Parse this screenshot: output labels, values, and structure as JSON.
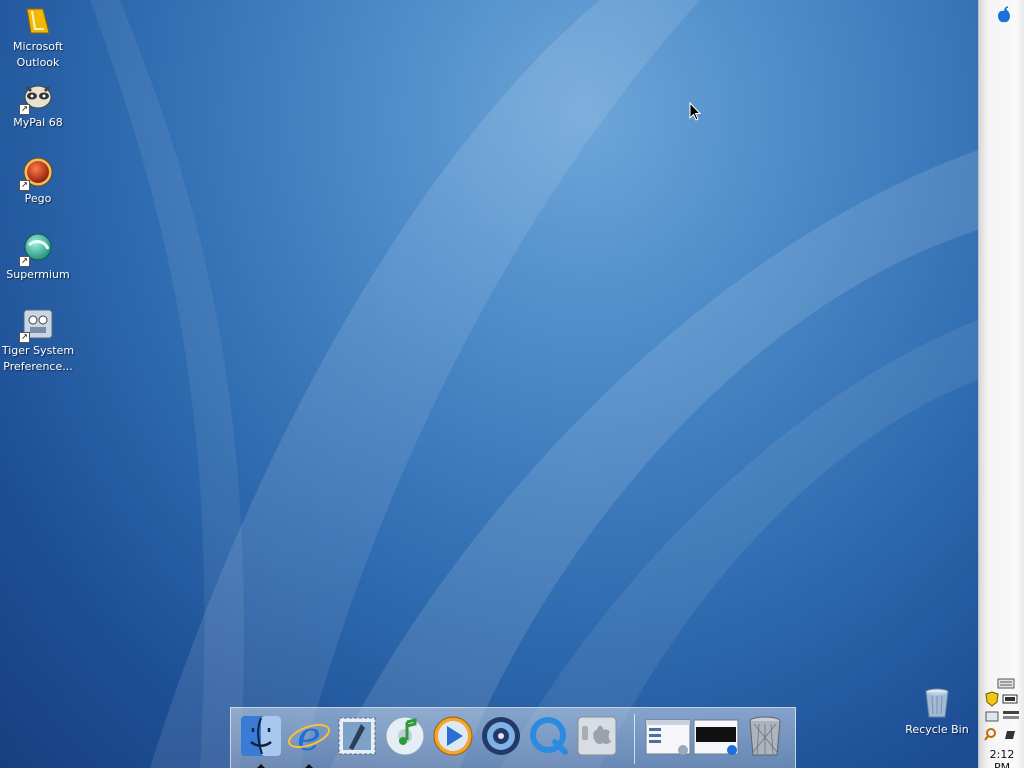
{
  "desktop_icons": [
    {
      "id": "outlook",
      "label_lines": [
        "Microsoft",
        "Outlook"
      ]
    },
    {
      "id": "mypal",
      "label_lines": [
        "MyPal 68"
      ]
    },
    {
      "id": "pego",
      "label_lines": [
        "Pego"
      ]
    },
    {
      "id": "supermium",
      "label_lines": [
        "Supermium"
      ]
    },
    {
      "id": "tiger-prefs",
      "label_lines": [
        "Tiger System",
        "Preference..."
      ]
    },
    {
      "id": "recycle-bin",
      "label_lines": [
        "Recycle Bin"
      ]
    }
  ],
  "clock": "2:12 PM",
  "dock_items": [
    {
      "name": "finder",
      "running": true
    },
    {
      "name": "internet-explorer",
      "running": true
    },
    {
      "name": "mail",
      "running": false
    },
    {
      "name": "itunes",
      "running": false
    },
    {
      "name": "media-player",
      "running": false
    },
    {
      "name": "dvd-player",
      "running": false
    },
    {
      "name": "quicktime",
      "running": false
    },
    {
      "name": "system-preferences",
      "running": false
    },
    {
      "name": "window-thumbnail-1",
      "running": false
    },
    {
      "name": "window-thumbnail-2",
      "running": false
    },
    {
      "name": "trash",
      "running": false
    }
  ],
  "colors": {
    "desktop_base": "#2f6bb0",
    "sidebar": "#f4f4f4",
    "accent": "#1e6fd9"
  }
}
